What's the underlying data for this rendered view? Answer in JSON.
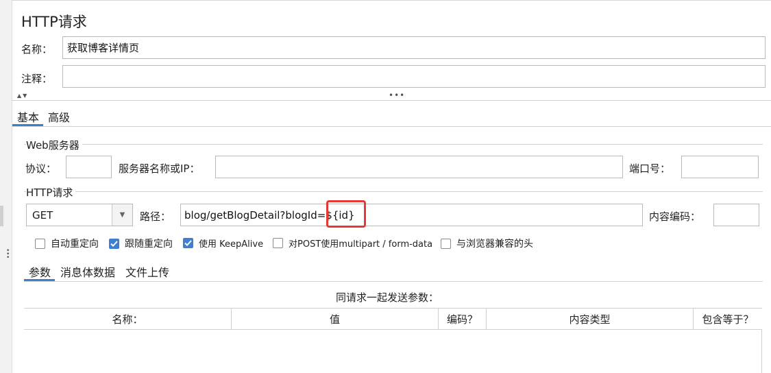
{
  "panel": {
    "title": "HTTP请求",
    "name_label": "名称：",
    "name_value": "获取博客详情页",
    "comment_label": "注释：",
    "comment_value": ""
  },
  "splitter": {
    "arrows": "▲▼",
    "dots": "•••"
  },
  "tabs": [
    {
      "label": "基本",
      "selected": true
    },
    {
      "label": "高级",
      "selected": false
    }
  ],
  "web_server": {
    "section_title": "Web服务器",
    "protocol_label": "协议：",
    "protocol_value": "",
    "server_label": "服务器名称或IP：",
    "server_value": "",
    "port_label": "端口号：",
    "port_value": ""
  },
  "http_request": {
    "section_title": "HTTP请求",
    "method": "GET",
    "path_label": "路径：",
    "path_value": "blog/getBlogDetail?blogId=${id}",
    "encoding_label": "内容编码：",
    "encoding_value": ""
  },
  "options": [
    {
      "label": "自动重定向",
      "checked": false
    },
    {
      "label": "跟随重定向",
      "checked": true
    },
    {
      "label": "使用 KeepAlive",
      "checked": true
    },
    {
      "label": "对POST使用multipart / form-data",
      "checked": false
    },
    {
      "label": "与浏览器兼容的头",
      "checked": false
    }
  ],
  "sub_tabs": [
    {
      "label": "参数",
      "selected": true
    },
    {
      "label": "消息体数据",
      "selected": false
    },
    {
      "label": "文件上传",
      "selected": false
    }
  ],
  "params": {
    "caption": "同请求一起发送参数：",
    "columns": [
      "名称：",
      "值",
      "编码？",
      "内容类型",
      "包含等于？"
    ],
    "rows": []
  },
  "colors": {
    "accent": "#3d80cf",
    "highlight": "#e53935"
  }
}
